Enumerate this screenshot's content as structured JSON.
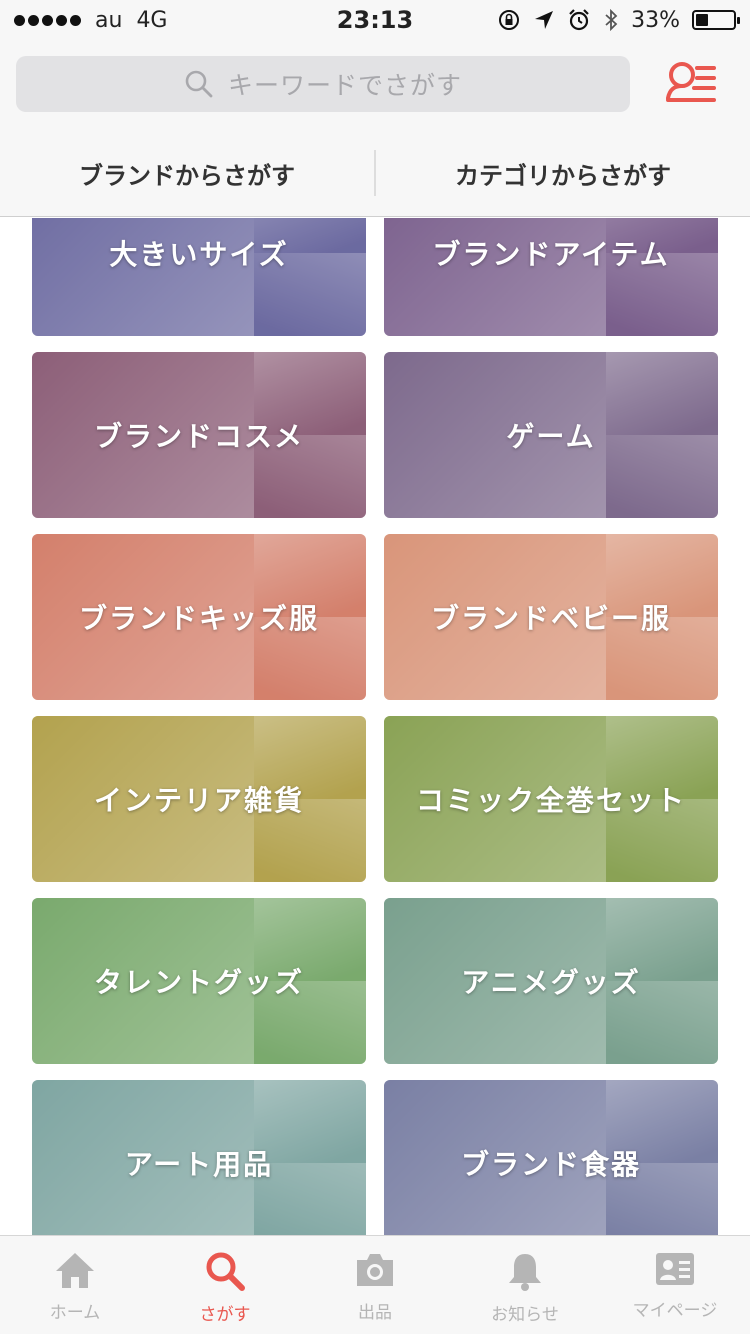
{
  "status_bar": {
    "carrier": "au",
    "network": "4G",
    "time": "23:13",
    "battery_text": "33%",
    "battery_level": 0.33,
    "icons": [
      "rotation-lock-icon",
      "location-arrow-icon",
      "alarm-icon",
      "bluetooth-icon"
    ]
  },
  "header": {
    "search_placeholder": "キーワードでさがす",
    "history_icon": "search-history-icon",
    "accent_color": "#e9574f"
  },
  "tabs": [
    {
      "label": "ブランドからさがす"
    },
    {
      "label": "カテゴリからさがす"
    }
  ],
  "categories": [
    {
      "label": "大きいサイズ",
      "tint": "#6c6aa0"
    },
    {
      "label": "ブランドアイテム",
      "tint": "#7a5f8c"
    },
    {
      "label": "ブランドコスメ",
      "tint": "#8d5f78"
    },
    {
      "label": "ゲーム",
      "tint": "#7d6a8d"
    },
    {
      "label": "ブランドキッズ服",
      "tint": "#d4806c"
    },
    {
      "label": "ブランドベビー服",
      "tint": "#d9957a"
    },
    {
      "label": "インテリア雑貨",
      "tint": "#b3a24f"
    },
    {
      "label": "コミック全巻セット",
      "tint": "#8aa355"
    },
    {
      "label": "タレントグッズ",
      "tint": "#7aaa6e"
    },
    {
      "label": "アニメグッズ",
      "tint": "#7aa08e"
    },
    {
      "label": "アート用品",
      "tint": "#7fa6a2"
    },
    {
      "label": "ブランド食器",
      "tint": "#7a80a4"
    }
  ],
  "tabbar": [
    {
      "label": "ホーム",
      "icon": "home-icon",
      "active": false
    },
    {
      "label": "さがす",
      "icon": "search-icon",
      "active": true
    },
    {
      "label": "出品",
      "icon": "camera-icon",
      "active": false
    },
    {
      "label": "お知らせ",
      "icon": "bell-icon",
      "active": false
    },
    {
      "label": "マイページ",
      "icon": "profile-card-icon",
      "active": false
    }
  ]
}
